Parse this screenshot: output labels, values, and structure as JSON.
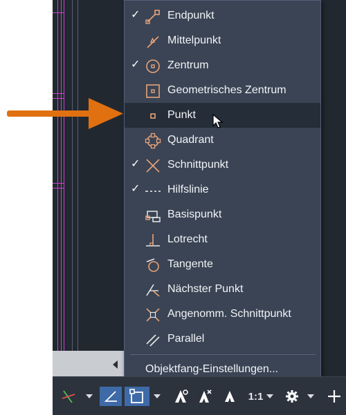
{
  "colors": {
    "canvas": "#212830",
    "menu_bg": "#3a4454",
    "menu_hover": "#252d39",
    "accent_orange": "#e07010",
    "snap_icon": "#e8a37a",
    "magenta_line": "#d23fd2",
    "active_button": "#3e6aa8"
  },
  "snap_menu": {
    "items": [
      {
        "label": "Endpunkt",
        "checked": true,
        "icon": "endpoint-snap-icon"
      },
      {
        "label": "Mittelpunkt",
        "checked": false,
        "icon": "midpoint-snap-icon"
      },
      {
        "label": "Zentrum",
        "checked": true,
        "icon": "center-snap-icon"
      },
      {
        "label": "Geometrisches Zentrum",
        "checked": false,
        "icon": "geometric-center-snap-icon"
      },
      {
        "label": "Punkt",
        "checked": false,
        "icon": "node-snap-icon",
        "hovered": true
      },
      {
        "label": "Quadrant",
        "checked": false,
        "icon": "quadrant-snap-icon"
      },
      {
        "label": "Schnittpunkt",
        "checked": true,
        "icon": "intersection-snap-icon"
      },
      {
        "label": "Hilfslinie",
        "checked": true,
        "icon": "extension-snap-icon"
      },
      {
        "label": "Basispunkt",
        "checked": false,
        "icon": "insertion-snap-icon"
      },
      {
        "label": "Lotrecht",
        "checked": false,
        "icon": "perpendicular-snap-icon"
      },
      {
        "label": "Tangente",
        "checked": false,
        "icon": "tangent-snap-icon"
      },
      {
        "label": "Nächster Punkt",
        "checked": false,
        "icon": "nearest-snap-icon"
      },
      {
        "label": "Angenomm. Schnittpunkt",
        "checked": false,
        "icon": "apparent-intersection-snap-icon"
      },
      {
        "label": "Parallel",
        "checked": false,
        "icon": "parallel-snap-icon"
      }
    ],
    "check_mark": "✓",
    "settings_label": "Objektfang-Einstellungen..."
  },
  "status_bar": {
    "scale_label": "1:1",
    "buttons": [
      {
        "name": "tracking-button",
        "icon": "polar-tracking-icon"
      },
      {
        "name": "isodraft-button",
        "icon": "angle-icon",
        "active": true
      },
      {
        "name": "object-snap-button",
        "icon": "object-snap-icon",
        "active": true
      },
      {
        "name": "annotation-visibility-button",
        "icon": "annotation-icon"
      },
      {
        "name": "auto-scale-button",
        "icon": "auto-scale-icon"
      },
      {
        "name": "annotation-scale-button",
        "icon": "annotation-scale-icon"
      },
      {
        "name": "workspace-button",
        "icon": "gear-icon"
      },
      {
        "name": "add-button",
        "icon": "plus-icon"
      }
    ]
  }
}
